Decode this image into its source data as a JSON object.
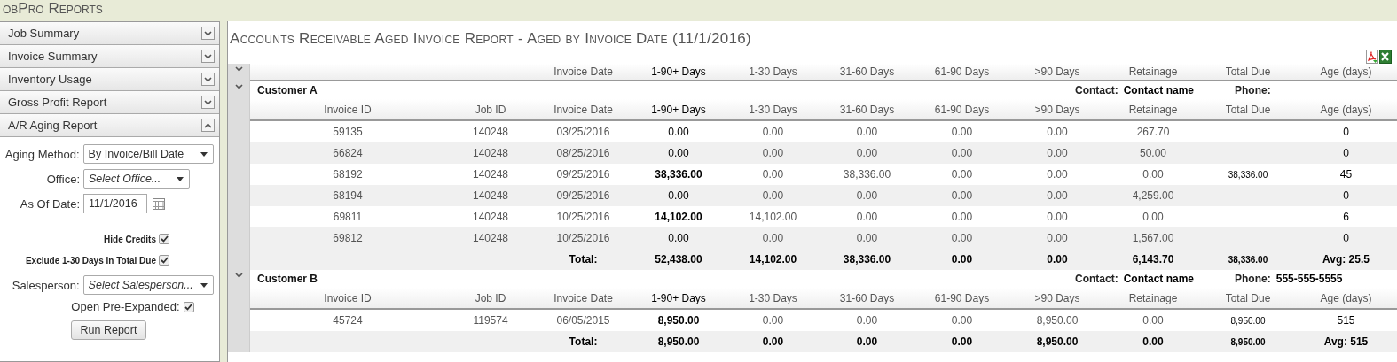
{
  "app_title": "obPro Reports",
  "sidebar": {
    "items": [
      {
        "label": "Job Summary",
        "expanded": false
      },
      {
        "label": "Invoice Summary",
        "expanded": false
      },
      {
        "label": "Inventory Usage",
        "expanded": false
      },
      {
        "label": "Gross Profit Report",
        "expanded": false
      },
      {
        "label": "A/R Aging Report",
        "expanded": true
      }
    ],
    "form": [
      {
        "kind": "select",
        "label": "Aging Method:",
        "value": "By Invoice/Bill Date",
        "wide": true
      },
      {
        "kind": "select",
        "label": "Office:",
        "placeholder": "Select Office...",
        "wide": false
      },
      {
        "kind": "date",
        "label": "As Of Date:",
        "value": "11/1/2016"
      },
      {
        "kind": "check",
        "label": "Hide Credits",
        "checked": true
      },
      {
        "kind": "check",
        "label": "Exclude 1-30 Days in Total Due",
        "checked": true
      },
      {
        "kind": "select",
        "label": "Salesperson:",
        "placeholder": "Select Salesperson...",
        "wide": true
      },
      {
        "kind": "inlinecheck",
        "label": "Open Pre-Expanded:",
        "checked": true
      }
    ],
    "button": "Run Report"
  },
  "report": {
    "title": "Accounts Receivable Aged Invoice Report - Aged by Invoice Date (11/1/2016)",
    "summary_header": {
      "expanded": true,
      "columns": [
        "Invoice Date",
        "1-90+ Days",
        "1-30 Days",
        "31-60 Days",
        "61-90 Days",
        ">90 Days",
        "Retainage",
        "Total Due",
        "Age (days)"
      ]
    },
    "customers": [
      {
        "name": "Customer A",
        "expanded": true,
        "contact_label": "Contact:",
        "contact": "Contact name",
        "phone_label": "Phone:",
        "columns": [
          "Invoice ID",
          "Job ID",
          "Invoice Date",
          "1-90+ Days",
          "1-30 Days",
          "31-60 Days",
          "61-90 Days",
          ">90 Days",
          "Retainage",
          "Total Due",
          "Age (days)"
        ],
        "rows": [
          [
            "59135",
            "140248",
            "03/25/2016",
            "0.00",
            "0.00",
            "0.00",
            "0.00",
            "0.00",
            "267.70",
            null,
            "0"
          ],
          [
            "66824",
            "140248",
            "08/25/2016",
            "0.00",
            "0.00",
            "0.00",
            "0.00",
            "0.00",
            "50.00",
            null,
            "0"
          ],
          [
            "68192",
            "140248",
            "09/25/2016",
            "38,336.00",
            "0.00",
            "38,336.00",
            "0.00",
            "0.00",
            "0.00",
            "38,336.00",
            "45"
          ],
          [
            "68194",
            "140248",
            "09/25/2016",
            "0.00",
            "0.00",
            "0.00",
            "0.00",
            "0.00",
            "4,259.00",
            null,
            "0"
          ],
          [
            "69811",
            "140248",
            "10/25/2016",
            "14,102.00",
            "14,102.00",
            "0.00",
            "0.00",
            "0.00",
            "0.00",
            null,
            "6"
          ],
          [
            "69812",
            "140248",
            "10/25/2016",
            "0.00",
            "0.00",
            "0.00",
            "0.00",
            "0.00",
            "1,567.00",
            null,
            "0"
          ]
        ],
        "total": {
          "label": "Total:",
          "values": [
            "52,438.00",
            "14,102.00",
            "38,336.00",
            "0.00",
            "0.00",
            "6,143.70",
            "38,336.00",
            "Avg: 25.5"
          ]
        }
      },
      {
        "name": "Customer B",
        "expanded": true,
        "contact_label": "Contact:",
        "contact": "Contact name",
        "phone_label": "Phone:",
        "phone": "555-555-5555",
        "columns": [
          "Invoice ID",
          "Job ID",
          "Invoice Date",
          "1-90+ Days",
          "1-30 Days",
          "31-60 Days",
          "61-90 Days",
          ">90 Days",
          "Retainage",
          "Total Due",
          "Age (days)"
        ],
        "rows": [
          [
            "45724",
            "119574",
            "06/05/2015",
            "8,950.00",
            "0.00",
            "0.00",
            "0.00",
            "8,950.00",
            "0.00",
            "8,950.00",
            "515"
          ]
        ],
        "total": {
          "label": "Total:",
          "values": [
            "8,950.00",
            "0.00",
            "0.00",
            "0.00",
            "8,950.00",
            "0.00",
            "8,950.00",
            "Avg: 515"
          ]
        }
      }
    ]
  }
}
